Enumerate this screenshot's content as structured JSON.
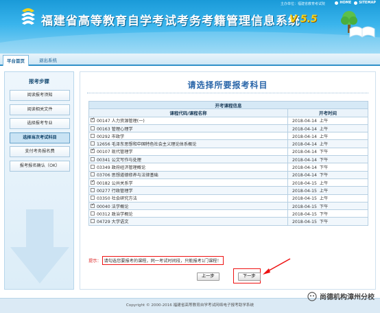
{
  "header": {
    "title": "福建省高等教育自学考试考务考籍管理信息系统",
    "version": "V 5.5",
    "unit": "主办单位：福建省教育考试院",
    "links": {
      "home": "HOME",
      "sitemap": "SITEMAP"
    }
  },
  "nav": {
    "tabs": [
      "平台首页",
      "退出系统"
    ]
  },
  "sidebar": {
    "title": "报考步骤",
    "steps": [
      "阅读报考须知",
      "阅读相关文件",
      "选择报考专业",
      "选择当次考试科目",
      "支付考务报名费",
      "报考报名确认（OK）"
    ],
    "active_index": 3
  },
  "main": {
    "heading": "请选择所要报考科目",
    "table_caption": "开考课程信息",
    "col_course": "课程代码/课程名称",
    "col_time": "开考时间",
    "rows": [
      {
        "course": "00147 人力资源管理(一)",
        "date": "2018-04-14",
        "period": "上午",
        "checked": true
      },
      {
        "course": "00163 管理心理学",
        "date": "2018-04-14",
        "period": "上午",
        "checked": false
      },
      {
        "course": "00292 市政学",
        "date": "2018-04-14",
        "period": "上午",
        "checked": false
      },
      {
        "course": "12656 毛泽东思想和中国特色社会主义理论体系概论",
        "date": "2018-04-14",
        "period": "上午",
        "checked": false
      },
      {
        "course": "00107 现代管理学",
        "date": "2018-04-14",
        "period": "下午",
        "checked": true
      },
      {
        "course": "00341 公文写作与处理",
        "date": "2018-04-14",
        "period": "下午",
        "checked": false
      },
      {
        "course": "03349 政府经济管理概论",
        "date": "2018-04-14",
        "period": "下午",
        "checked": false
      },
      {
        "course": "03706 思想道德修养与法律基础",
        "date": "2018-04-14",
        "period": "下午",
        "checked": false
      },
      {
        "course": "00182 公共关系学",
        "date": "2018-04-15",
        "period": "上午",
        "checked": true
      },
      {
        "course": "00277 行政管理学",
        "date": "2018-04-15",
        "period": "上午",
        "checked": false
      },
      {
        "course": "03350 社会研究方法",
        "date": "2018-04-15",
        "period": "上午",
        "checked": false
      },
      {
        "course": "00040 法学概论",
        "date": "2018-04-15",
        "period": "下午",
        "checked": true
      },
      {
        "course": "00312 政治学概论",
        "date": "2018-04-15",
        "period": "下午",
        "checked": false
      },
      {
        "course": "04729 大学语文",
        "date": "2018-04-15",
        "period": "下午",
        "checked": false
      }
    ],
    "notice_label": "提示：",
    "notice": "请勾选您要报考的课程，同一考试时间段，只能报考1门课程！",
    "btn_prev": "上一步",
    "btn_next": "下一步"
  },
  "footer": {
    "copyright": "Copyright © 2000-2016 福建省高等教育自学考试网络电子报考助学系统"
  },
  "watermark": "尚德机构漳州分校",
  "colors": {
    "header_blue": "#1a9ad8",
    "accent_red": "#e11",
    "heading_blue": "#2764a8"
  }
}
